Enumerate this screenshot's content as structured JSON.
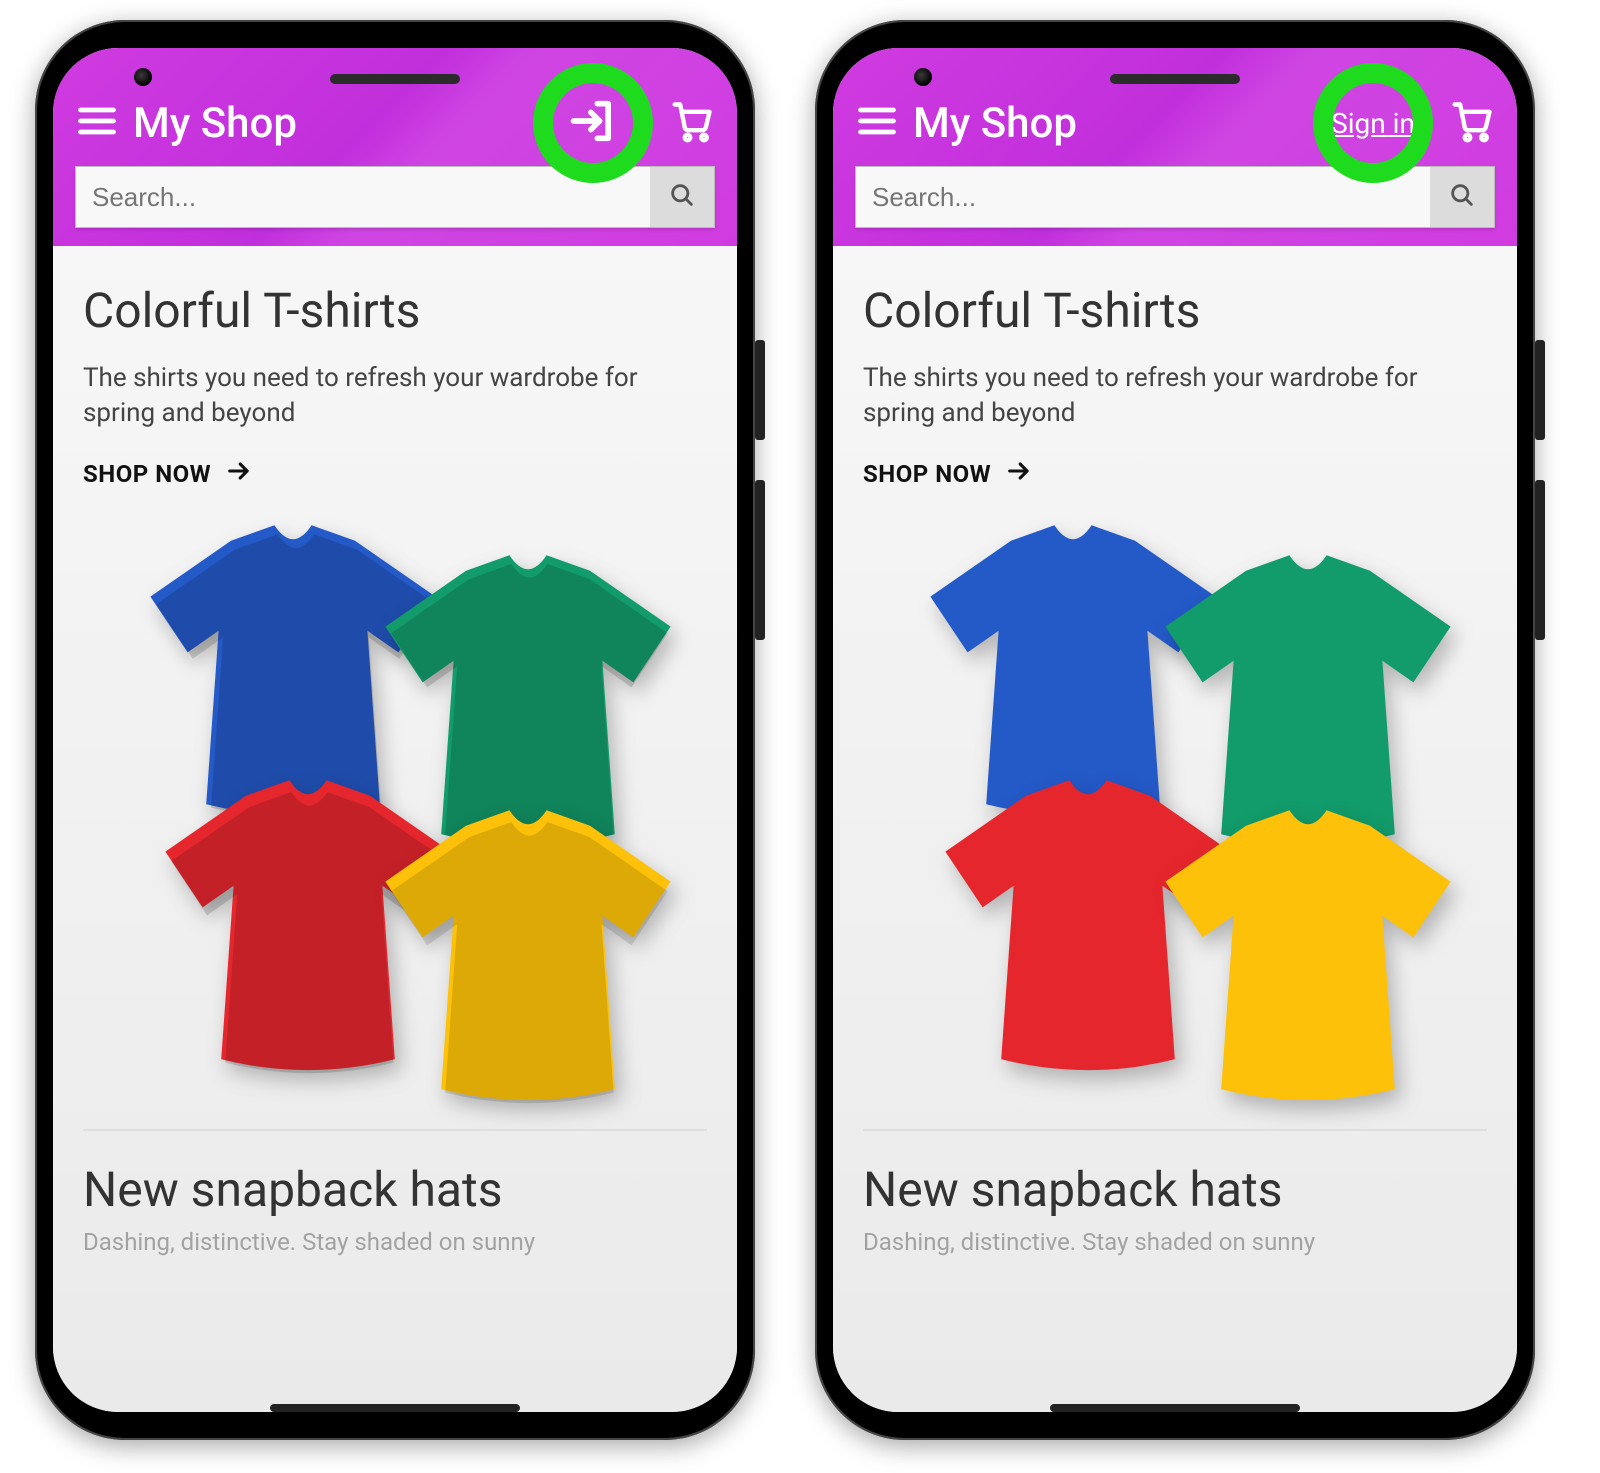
{
  "app_title": "My Shop",
  "search_placeholder": "Search...",
  "cta_variant_left": "icon",
  "cta_variant_right": "text",
  "signin_label": "Sign in",
  "hero": {
    "title": "Colorful T-shirts",
    "subtitle": "The shirts you need to refresh your wardrobe for spring and beyond",
    "cta": "SHOP NOW"
  },
  "second_hero": {
    "title": "New snapback hats",
    "subtitle_partial": "Dashing, distinctive. Stay shaded on sunny"
  },
  "colors": {
    "accent": "#d03be0",
    "highlight_ring": "#1edb1e",
    "shirt_blue": "#2459c8",
    "shirt_green": "#129b6b",
    "shirt_red": "#e6262d",
    "shirt_yellow": "#fcc108"
  }
}
